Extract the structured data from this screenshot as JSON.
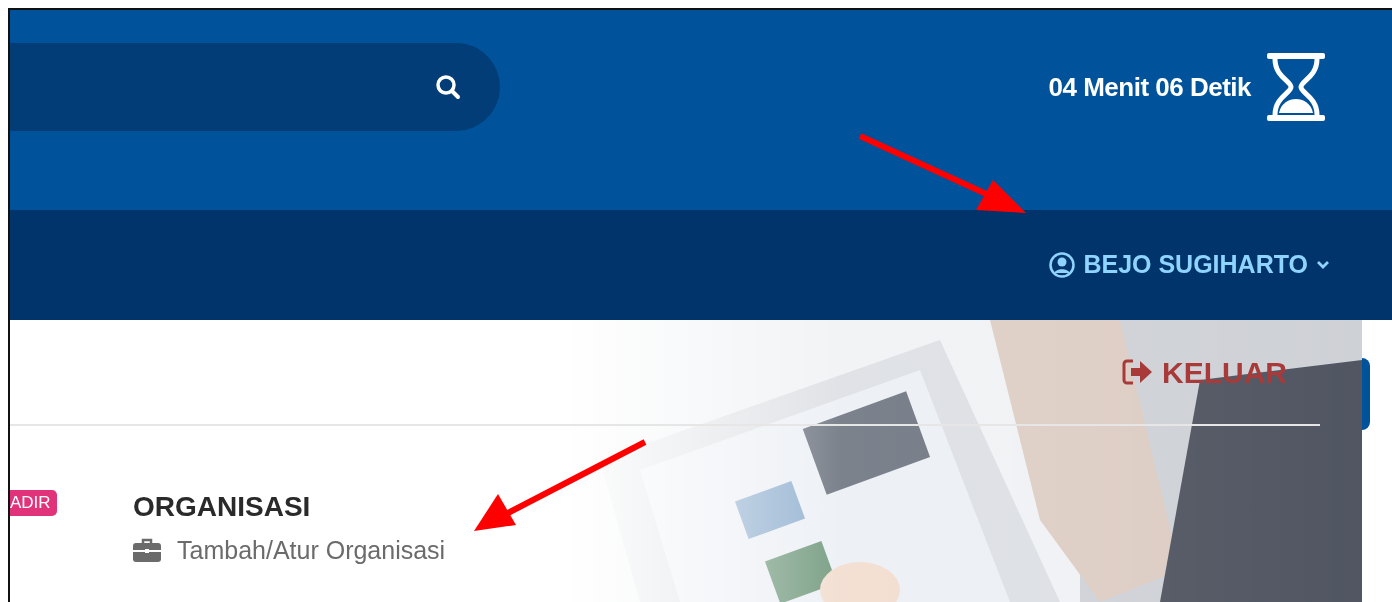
{
  "header": {
    "timer": "04 Menit 06 Detik"
  },
  "user_menu": {
    "name": "BEJO SUGIHARTO"
  },
  "logout": {
    "label": "KELUAR"
  },
  "badge": {
    "label": "ADIR"
  },
  "section": {
    "title": "ORGANISASI",
    "links": [
      {
        "label": "Tambah/Atur Organisasi"
      }
    ]
  }
}
